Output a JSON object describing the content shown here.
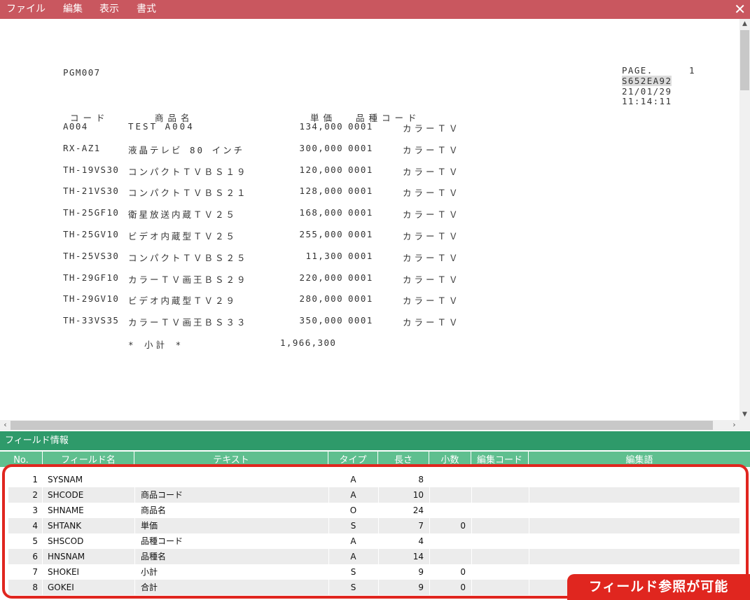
{
  "menu": {
    "items": [
      "ファイル",
      "編集",
      "表示",
      "書式"
    ],
    "close_glyph": "✕"
  },
  "report": {
    "program": "PGM007",
    "page_label": "PAGE.",
    "page_number": "1",
    "system_name": "S652EA92",
    "date": "21/01/29",
    "time": "11:14:11",
    "header": {
      "code": "コード",
      "name": "商品名",
      "price": "単価",
      "category_code": "品種コード"
    },
    "rows": [
      {
        "code": "A004",
        "name": "TEST A004",
        "price": "134,000",
        "category_code": "0001",
        "category_name": "カラーＴＶ"
      },
      {
        "code": "RX-AZ1",
        "name": "液晶テレビ 80 インチ",
        "price": "300,000",
        "category_code": "0001",
        "category_name": "カラーＴＶ"
      },
      {
        "code": "TH-19VS30",
        "name": "コンパクトＴＶＢＳ１９",
        "price": "120,000",
        "category_code": "0001",
        "category_name": "カラーＴＶ"
      },
      {
        "code": "TH-21VS30",
        "name": "コンパクトＴＶＢＳ２１",
        "price": "128,000",
        "category_code": "0001",
        "category_name": "カラーＴＶ"
      },
      {
        "code": "TH-25GF10",
        "name": "衛星放送内蔵ＴＶ２５",
        "price": "168,000",
        "category_code": "0001",
        "category_name": "カラーＴＶ"
      },
      {
        "code": "TH-25GV10",
        "name": "ビデオ内蔵型ＴＶ２５",
        "price": "255,000",
        "category_code": "0001",
        "category_name": "カラーＴＶ"
      },
      {
        "code": "TH-25VS30",
        "name": "コンパクトＴＶＢＳ２５",
        "price": "11,300",
        "category_code": "0001",
        "category_name": "カラーＴＶ"
      },
      {
        "code": "TH-29GF10",
        "name": "カラーＴＶ画王ＢＳ２９",
        "price": "220,000",
        "category_code": "0001",
        "category_name": "カラーＴＶ"
      },
      {
        "code": "TH-29GV10",
        "name": "ビデオ内蔵型ＴＶ２９",
        "price": "280,000",
        "category_code": "0001",
        "category_name": "カラーＴＶ"
      },
      {
        "code": "TH-33VS35",
        "name": "カラーＴＶ画王ＢＳ３３",
        "price": "350,000",
        "category_code": "0001",
        "category_name": "カラーＴＶ"
      }
    ],
    "subtotal_label": "* 小計 *",
    "subtotal_value": "1,966,300"
  },
  "field_panel": {
    "title": "フィールド情報",
    "columns": [
      "No.",
      "フィールド名",
      "テキスト",
      "タイプ",
      "長さ",
      "小数",
      "編集コード",
      "編集語"
    ],
    "rows": [
      {
        "no": "1",
        "field": "SYSNAM",
        "text": "",
        "type": "A",
        "length": "8",
        "decimals": ""
      },
      {
        "no": "2",
        "field": "SHCODE",
        "text": "商品コード",
        "type": "A",
        "length": "10",
        "decimals": ""
      },
      {
        "no": "3",
        "field": "SHNAME",
        "text": "商品名",
        "type": "O",
        "length": "24",
        "decimals": ""
      },
      {
        "no": "4",
        "field": "SHTANK",
        "text": "単価",
        "type": "S",
        "length": "7",
        "decimals": "0"
      },
      {
        "no": "5",
        "field": "SHSCOD",
        "text": "品種コード",
        "type": "A",
        "length": "4",
        "decimals": ""
      },
      {
        "no": "6",
        "field": "HNSNAM",
        "text": "品種名",
        "type": "A",
        "length": "14",
        "decimals": ""
      },
      {
        "no": "7",
        "field": "SHOKEI",
        "text": "小計",
        "type": "S",
        "length": "9",
        "decimals": "0"
      },
      {
        "no": "8",
        "field": "GOKEI",
        "text": "合計",
        "type": "S",
        "length": "9",
        "decimals": "0"
      }
    ],
    "callout": "フィールド参照が可能"
  },
  "colors": {
    "menubar": "#c9575f",
    "panel_title": "#2e9a6a",
    "table_header": "#5fbf8f",
    "callout_red": "#e0261f"
  }
}
